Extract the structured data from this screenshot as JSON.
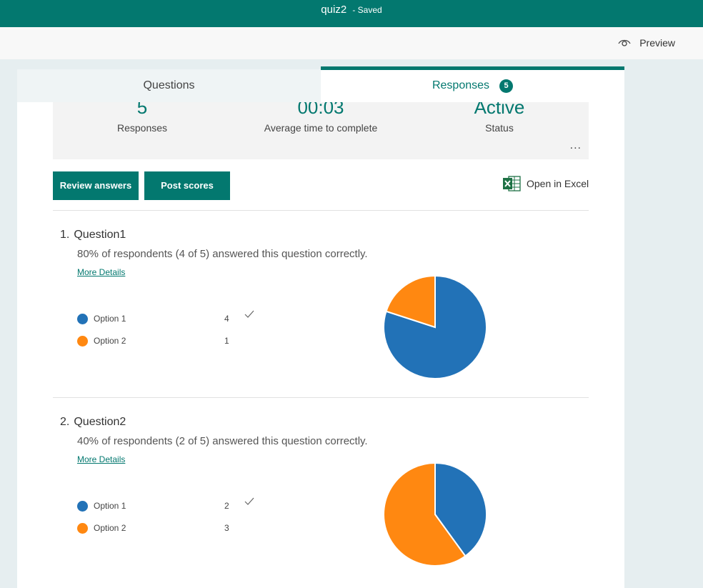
{
  "header": {
    "title": "quiz2",
    "status": "- Saved"
  },
  "toolbar": {
    "preview_label": "Preview"
  },
  "tabs": {
    "questions": "Questions",
    "responses": "Responses",
    "responses_count": "5"
  },
  "summary": {
    "responses": {
      "value": "5",
      "label": "Responses"
    },
    "avg_time": {
      "value": "00:03",
      "label": "Average time to complete"
    },
    "status": {
      "value": "Active",
      "label": "Status"
    },
    "more": "..."
  },
  "actions": {
    "review": "Review answers",
    "post": "Post scores",
    "excel": "Open in Excel"
  },
  "colors": {
    "brand": "#03786f",
    "option1": "#2272b7",
    "option2": "#ff8811"
  },
  "questions": [
    {
      "number": "1.",
      "title": "Question1",
      "summary": "80% of respondents (4 of 5) answered this question correctly.",
      "more": "More Details",
      "options": [
        {
          "label": "Option 1",
          "count": "4",
          "correct": "✓",
          "color": "#2272b7"
        },
        {
          "label": "Option 2",
          "count": "1",
          "correct": "",
          "color": "#ff8811"
        }
      ]
    },
    {
      "number": "2.",
      "title": "Question2",
      "summary": "40% of respondents (2 of 5) answered this question correctly.",
      "more": "More Details",
      "options": [
        {
          "label": "Option 1",
          "count": "2",
          "correct": "✓",
          "color": "#2272b7"
        },
        {
          "label": "Option 2",
          "count": "3",
          "correct": "",
          "color": "#ff8811"
        }
      ]
    }
  ],
  "chart_data": [
    {
      "type": "pie",
      "categories": [
        "Option 1",
        "Option 2"
      ],
      "values": [
        4,
        1
      ],
      "colors": [
        "#2272b7",
        "#ff8811"
      ]
    },
    {
      "type": "pie",
      "categories": [
        "Option 1",
        "Option 2"
      ],
      "values": [
        2,
        3
      ],
      "colors": [
        "#2272b7",
        "#ff8811"
      ]
    }
  ]
}
